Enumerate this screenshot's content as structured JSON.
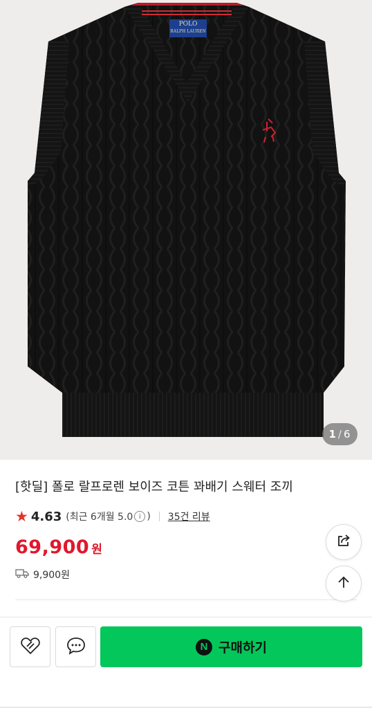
{
  "product": {
    "image_counter": {
      "current": "1",
      "separator": "/",
      "total": "6"
    },
    "title": "[핫딜] 폴로 랄프로렌 보이즈 코튼 꽈배기 스웨터 조끼",
    "label_brand_top": "POLO",
    "label_brand_bottom": "RALPH LAUREN"
  },
  "rating": {
    "score": "4.63",
    "recent_open": "(최근 6개월 5.0",
    "info_glyph": "i",
    "recent_close": ")",
    "reviews_label": "35건 리뷰"
  },
  "price": {
    "amount": "69,900",
    "unit": "원"
  },
  "shipping": {
    "fee": "9,900원"
  },
  "buttons": {
    "buy_label": "구매하기",
    "npay_glyph": "N"
  },
  "colors": {
    "price_red": "#e0182c",
    "star_red": "#e5332a",
    "buy_green": "#03c75a",
    "hero_bg": "#eeedeb"
  },
  "icons": [
    "star-icon",
    "info-icon",
    "truck-icon",
    "share-icon",
    "arrow-up-icon",
    "heart-link-icon",
    "chat-icon",
    "npay-icon"
  ]
}
